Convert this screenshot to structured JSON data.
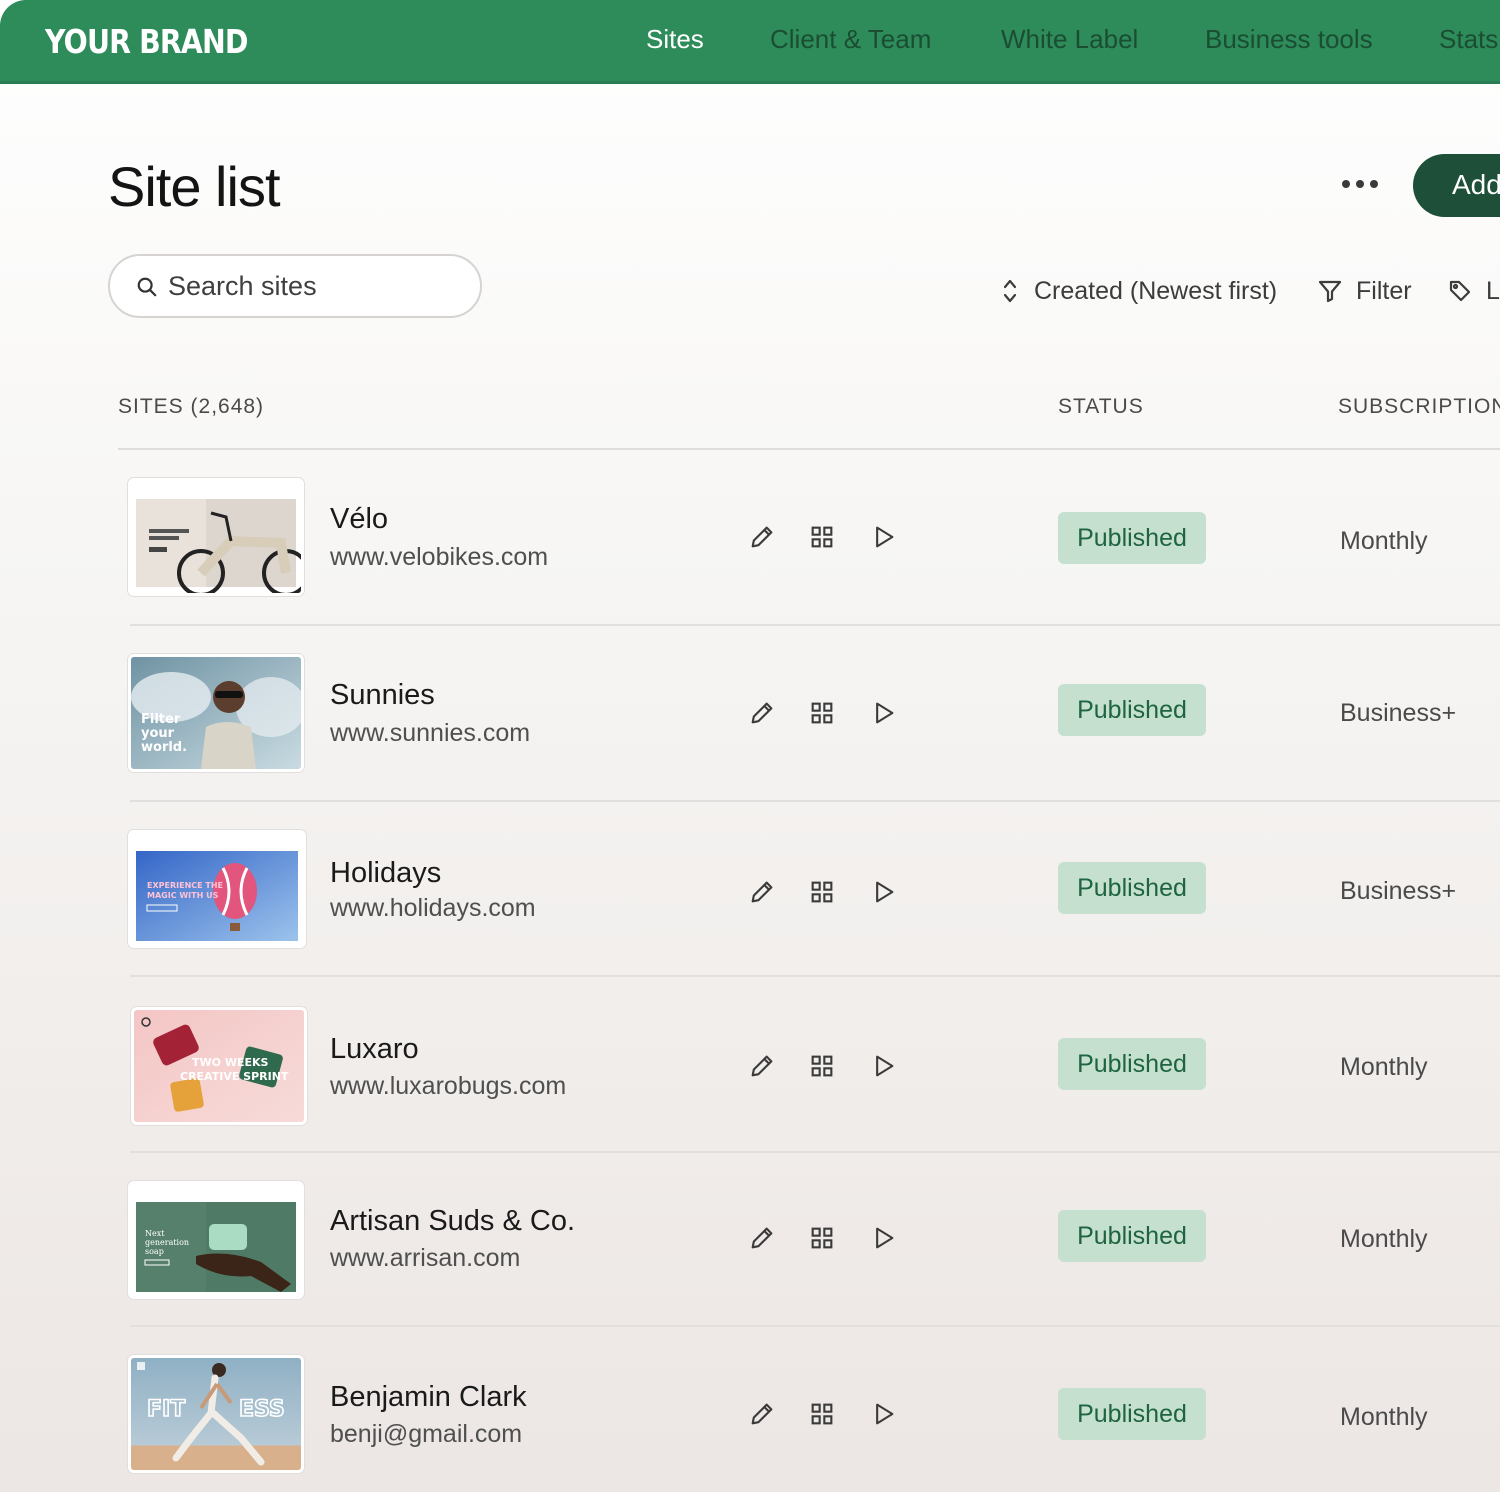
{
  "nav": {
    "brand": "YOUR BRAND",
    "items": [
      {
        "label": "Sites",
        "active": true
      },
      {
        "label": "Client & Team",
        "active": false
      },
      {
        "label": "White Label",
        "active": false
      },
      {
        "label": "Business tools",
        "active": false
      },
      {
        "label": "Stats",
        "active": false
      }
    ]
  },
  "header": {
    "title": "Site list",
    "add_label": "Add"
  },
  "search": {
    "placeholder": "Search sites"
  },
  "toolbar": {
    "sort_label": "Created (Newest first)",
    "filter_label": "Filter",
    "label_label": "Label"
  },
  "table": {
    "col_sites": "SITES (2,648)",
    "col_status": "STATUS",
    "col_subscription": "SUBSCRIPTION",
    "rows": [
      {
        "name": "Vélo",
        "url": "www.velobikes.com",
        "status": "Published",
        "plan": "Monthly"
      },
      {
        "name": "Sunnies",
        "url": "www.sunnies.com",
        "status": "Published",
        "plan": "Business+"
      },
      {
        "name": "Holidays",
        "url": "www.holidays.com",
        "status": "Published",
        "plan": "Business+"
      },
      {
        "name": "Luxaro",
        "url": "www.luxarobugs.com",
        "status": "Published",
        "plan": "Monthly"
      },
      {
        "name": "Artisan Suds & Co.",
        "url": "www.arrisan.com",
        "status": "Published",
        "plan": "Monthly"
      },
      {
        "name": "Benjamin Clark",
        "url": "benji@gmail.com",
        "status": "Published",
        "plan": "Monthly"
      }
    ]
  },
  "colors": {
    "nav_bg": "#2e8b5a",
    "add_button": "#1e4f38",
    "badge_bg": "#c5e0cf",
    "badge_text": "#1f6440"
  },
  "icons": {
    "search": "search-icon",
    "sort": "sort-icon",
    "filter": "filter-icon",
    "label": "tag-icon",
    "more": "more-horizontal-icon",
    "edit": "pencil-icon",
    "dashboard": "grid-icon",
    "preview": "play-icon"
  }
}
